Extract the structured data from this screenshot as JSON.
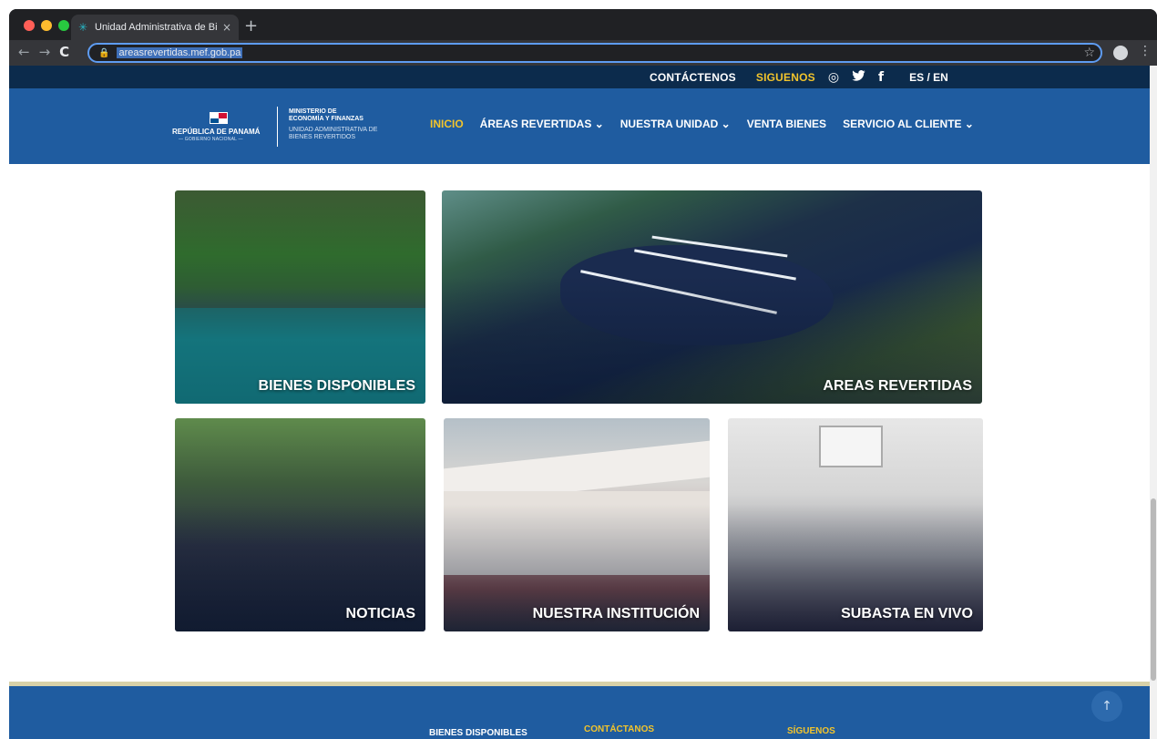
{
  "browser": {
    "tab_title": "Unidad Administrativa de Biene",
    "tab_close": "×",
    "new_tab": "+",
    "url": "areasrevertidas.mef.gob.pa",
    "back": "←",
    "forward": "→",
    "reload": "C",
    "star": "☆",
    "menu": "⋮",
    "traffic_light_colors": [
      "#ff5f57",
      "#febc2e",
      "#28c840"
    ]
  },
  "topbar": {
    "contact": "CONTÁCTENOS",
    "follow": "SIGUENOS",
    "instagram": "◎",
    "twitter": "🐦",
    "facebook": "f",
    "language": "ES / EN"
  },
  "logo": {
    "republic": "REPÚBLICA DE PANAMÁ",
    "government": "— GOBIERNO NACIONAL —",
    "ministry_line1": "MINISTERIO DE",
    "ministry_line2": "ECONOMÍA Y FINANZAS",
    "unit_line1": "UNIDAD ADMINISTRATIVA DE",
    "unit_line2": "BIENES REVERTIDOS"
  },
  "menu": {
    "items": [
      {
        "label": "INICIO"
      },
      {
        "label": "ÁREAS REVERTIDAS ⌄"
      },
      {
        "label": "NUESTRA UNIDAD ⌄"
      },
      {
        "label": "VENTA BIENES"
      },
      {
        "label": "SERVICIO AL CLIENTE ⌄"
      }
    ]
  },
  "cards": {
    "bienes": "BIENES DISPONIBLES",
    "areas": "AREAS REVERTIDAS",
    "noticias": "NOTICIAS",
    "institucion": "NUESTRA INSTITUCIÓN",
    "subasta": "SUBASTA EN VIVO"
  },
  "footer": {
    "col1": "BIENES DISPONIBLES",
    "col2": "CONTÁCTANOS",
    "col3": "SÍGUENOS",
    "to_top": "↑"
  },
  "colors": {
    "navy": "#0c2b4c",
    "brand_blue": "#1f5ca0",
    "gold": "#f2c42c"
  }
}
